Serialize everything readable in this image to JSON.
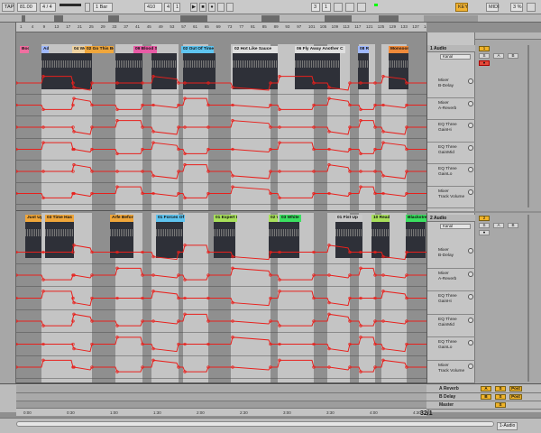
{
  "transport": {
    "tap_label": "TAP",
    "tempo": "81.00",
    "signature": "4 / 4",
    "quant": "1 Bar",
    "position": "410",
    "position_sub": "4",
    "position_sub2": "1",
    "loop_start": "3",
    "loop_len": "1",
    "key_label": "KEY",
    "midi_label": "MIDI",
    "percent": "3 %"
  },
  "ruler": {
    "ticks": [
      "1",
      "4",
      "9",
      "13",
      "17",
      "21",
      "25",
      "29",
      "33",
      "37",
      "41",
      "45",
      "49",
      "53",
      "57",
      "61",
      "65",
      "69",
      "73",
      "77",
      "81",
      "85",
      "89",
      "93",
      "97",
      "101",
      "105",
      "109",
      "113",
      "117",
      "121",
      "125",
      "129",
      "133",
      "137",
      "141"
    ]
  },
  "bottom_ruler": {
    "ticks": [
      "0:00",
      "0:30",
      "1:00",
      "1:30",
      "2:00",
      "2:30",
      "3:00",
      "3:30",
      "4:00",
      "4:30"
    ]
  },
  "tracks": [
    {
      "name": "1 Audio",
      "number_label": "1",
      "clip_slot": "Kanal",
      "clips": [
        {
          "label": "Boo",
          "color": "#f06fa0"
        },
        {
          "label": "Adr",
          "color": "#9fb8ff"
        },
        {
          "label": "04 Wo",
          "color": "#f0d3a0"
        },
        {
          "label": "02 Go This Bor",
          "color": "#f0a63a"
        },
        {
          "label": "09 Blood Sp",
          "color": "#e85aa5"
        },
        {
          "label": "02 Out Of Time",
          "color": "#5ec4f0"
        },
        {
          "label": "02 Hot Like Sauce",
          "color": "#e0e0e0"
        },
        {
          "label": "06 Fly Away Another C",
          "color": "#e0e0e0"
        },
        {
          "label": "08 Ro",
          "color": "#9fb8ff"
        },
        {
          "label": "Monsoon",
          "color": "#f08a3a"
        }
      ],
      "devices": [
        {
          "name": "Mixer",
          "param": "B-Delay"
        },
        {
          "name": "Mixer",
          "param": "A-Reverb"
        },
        {
          "name": "EQ Three",
          "param": "GainHi"
        },
        {
          "name": "EQ Three",
          "param": "GainMid"
        },
        {
          "name": "EQ Three",
          "param": "GainLo"
        },
        {
          "name": "Mixer",
          "param": "Track Volume"
        }
      ]
    },
    {
      "name": "2 Audio",
      "number_label": "2",
      "clip_slot": "Kanal",
      "clips": [
        {
          "label": "Just Up",
          "color": "#f0a63a"
        },
        {
          "label": "03 Time Has",
          "color": "#f0a63a"
        },
        {
          "label": "Arfe Before",
          "color": "#f0a63a"
        },
        {
          "label": "01 Forces Of",
          "color": "#5ec4f0"
        },
        {
          "label": "01 Expert L",
          "color": "#a8e05a"
        },
        {
          "label": "02 W",
          "color": "#a8e05a"
        },
        {
          "label": "03 White",
          "color": "#3ae060"
        },
        {
          "label": "01 Fist Up",
          "color": "#c9c9c9"
        },
        {
          "label": "10 Ready",
          "color": "#a8e05a"
        },
        {
          "label": "Blackstream",
          "color": "#3ae060"
        }
      ],
      "devices": [
        {
          "name": "Mixer",
          "param": "B-Delay"
        },
        {
          "name": "Mixer",
          "param": "A-Reverb"
        },
        {
          "name": "EQ Three",
          "param": "GainHi"
        },
        {
          "name": "EQ Three",
          "param": "GainMid"
        },
        {
          "name": "EQ Three",
          "param": "GainLo"
        },
        {
          "name": "Mixer",
          "param": "Track Volume"
        }
      ]
    }
  ],
  "returns": [
    {
      "name": "A Reverb",
      "letter": "A",
      "post": "Post"
    },
    {
      "name": "B Delay",
      "letter": "B",
      "post": "Post"
    },
    {
      "name": "Master",
      "letter": "",
      "post": ""
    }
  ],
  "mixer_buttons": {
    "solo": "S",
    "cue": "C",
    "arm": "●",
    "send_a": "A",
    "send_b": "B"
  },
  "status": {
    "counter": "32/1",
    "track_select": "1-Audio"
  },
  "colors": {
    "automation": "#e8201c",
    "active_button": "#f0b329",
    "clip_background": "#2e3038"
  }
}
